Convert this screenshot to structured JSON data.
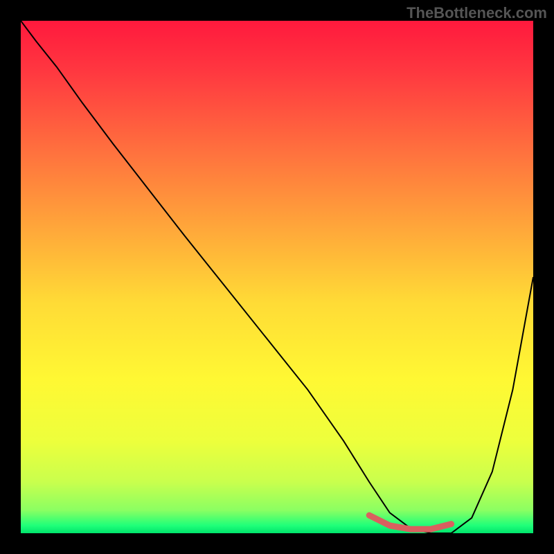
{
  "watermark": "TheBottleneck.com",
  "chart_data": {
    "type": "line",
    "title": "",
    "xlabel": "",
    "ylabel": "",
    "xlim": [
      0,
      100
    ],
    "ylim": [
      0,
      100
    ],
    "gradient_stops": [
      {
        "offset": 0.0,
        "color": "#ff193d"
      },
      {
        "offset": 0.1,
        "color": "#ff3840"
      },
      {
        "offset": 0.25,
        "color": "#ff6f3e"
      },
      {
        "offset": 0.4,
        "color": "#ffa53a"
      },
      {
        "offset": 0.55,
        "color": "#ffdb36"
      },
      {
        "offset": 0.7,
        "color": "#fff833"
      },
      {
        "offset": 0.82,
        "color": "#edff3c"
      },
      {
        "offset": 0.9,
        "color": "#c9ff4d"
      },
      {
        "offset": 0.955,
        "color": "#8bff62"
      },
      {
        "offset": 0.985,
        "color": "#1fff79"
      },
      {
        "offset": 1.0,
        "color": "#00e36c"
      }
    ],
    "series": [
      {
        "name": "bottleneck-curve",
        "color": "#000000",
        "x": [
          0,
          3,
          7,
          12,
          18,
          25,
          32,
          40,
          48,
          56,
          63,
          68,
          72,
          76,
          80,
          84,
          88,
          92,
          96,
          100
        ],
        "y": [
          100,
          96,
          91,
          84,
          76,
          67,
          58,
          48,
          38,
          28,
          18,
          10,
          4,
          1,
          0,
          0,
          3,
          12,
          28,
          50
        ]
      }
    ],
    "highlight_band": {
      "name": "optimal-range",
      "color": "#d9605f",
      "x": [
        68,
        72,
        76,
        80,
        84
      ],
      "y": [
        3.5,
        1.5,
        0.8,
        0.8,
        1.8
      ]
    }
  }
}
